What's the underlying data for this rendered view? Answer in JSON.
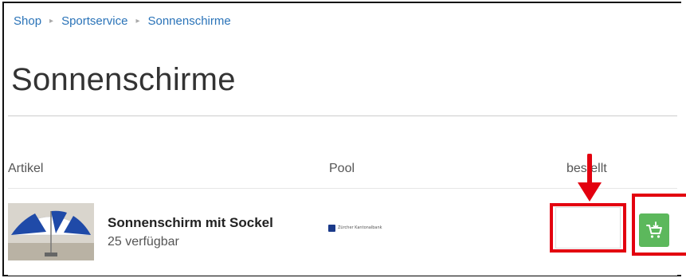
{
  "breadcrumb": {
    "items": [
      {
        "label": "Shop"
      },
      {
        "label": "Sportservice"
      },
      {
        "label": "Sonnenschirme"
      }
    ],
    "separator": "▸"
  },
  "page": {
    "title": "Sonnenschirme"
  },
  "table": {
    "headers": {
      "article": "Artikel",
      "pool": "Pool",
      "ordered": "bestellt"
    },
    "rows": [
      {
        "name": "Sonnenschirm mit Sockel",
        "availability": "25 verfügbar",
        "pool_logo_text": "Zürcher Kantonalbank",
        "ordered_value": ""
      }
    ]
  },
  "icons": {
    "cart": "add-to-cart-icon",
    "thumbnail": "umbrella-image"
  },
  "colors": {
    "link": "#2a73b8",
    "button": "#5cb85c",
    "annotation": "#e3000f",
    "pool_logo": "#1b3a8a"
  }
}
